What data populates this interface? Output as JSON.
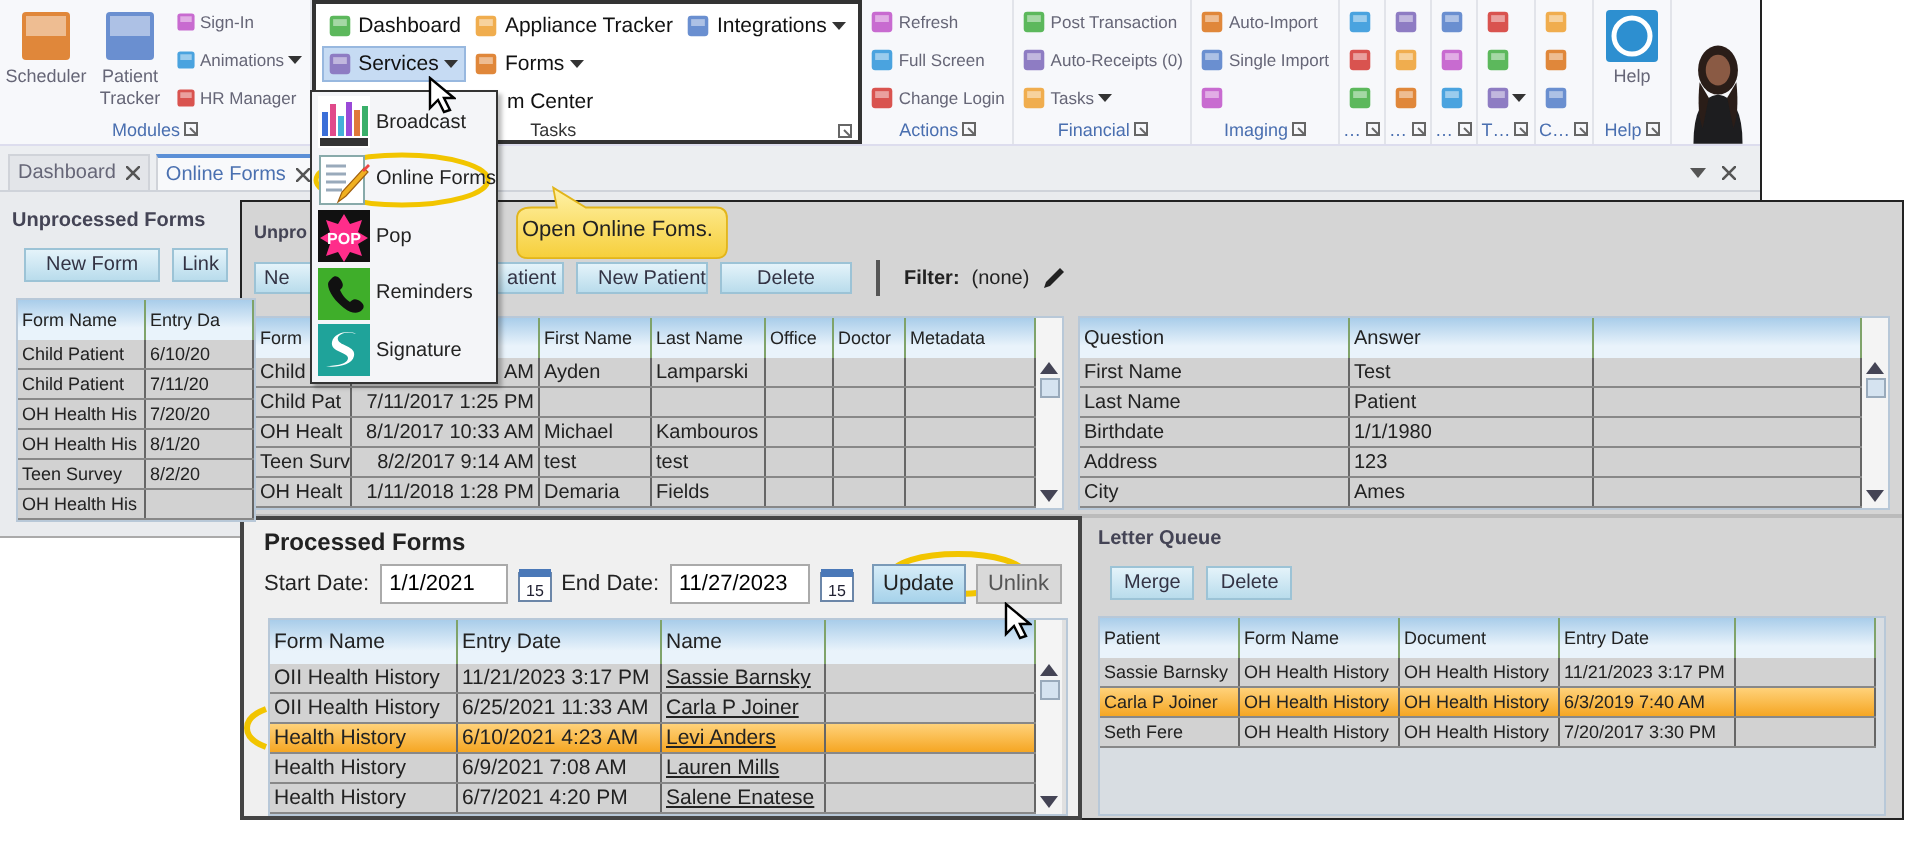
{
  "app": {
    "ribbon": {
      "groups": [
        {
          "label": "Modules",
          "columns": [
            [
              {
                "kind": "large",
                "label": "Scheduler"
              }
            ],
            [
              {
                "kind": "large",
                "label": "Patient Tracker"
              }
            ],
            [
              {
                "kind": "small",
                "label": "Sign-In"
              },
              {
                "kind": "small",
                "label": "Animations",
                "menu": true
              },
              {
                "kind": "small",
                "label": "HR Manager"
              }
            ]
          ]
        },
        {
          "kind": "focus",
          "label": "Tasks",
          "columns": [
            [
              {
                "kind": "small",
                "label": "Dashboard",
                "pressed": false
              },
              {
                "kind": "small",
                "label": "Services",
                "menu": true,
                "pressed": true
              }
            ],
            [
              {
                "kind": "small",
                "label": "Appliance Tracker",
                "pressed": false
              },
              {
                "kind": "small",
                "label": "Forms",
                "menu": true,
                "pressed": false
              },
              {
                "kind": "partial",
                "label": "m Center",
                "pressed": false
              }
            ],
            [
              {
                "kind": "small",
                "label": "Integrations",
                "menu": true,
                "pressed": false
              }
            ]
          ]
        },
        {
          "label": "Actions",
          "columns": [
            [
              {
                "kind": "small",
                "label": "Refresh"
              },
              {
                "kind": "small",
                "label": "Full Screen"
              },
              {
                "kind": "small",
                "label": "Change Login"
              }
            ]
          ]
        },
        {
          "label": "Financial",
          "columns": [
            [
              {
                "kind": "small",
                "label": "Post Transaction"
              },
              {
                "kind": "small",
                "label": "Auto-Receipts (0)"
              },
              {
                "kind": "small",
                "label": "Tasks",
                "menu": true
              }
            ]
          ]
        },
        {
          "label": "Imaging",
          "columns": [
            [
              {
                "kind": "small",
                "label": "Auto-Import"
              },
              {
                "kind": "small",
                "label": "Single Import"
              },
              {
                "kind": "icon"
              }
            ]
          ]
        },
        {
          "label": "…",
          "columns": [
            [
              {
                "kind": "icon"
              },
              {
                "kind": "icon"
              },
              {
                "kind": "icon"
              }
            ]
          ]
        },
        {
          "label": "…",
          "columns": [
            [
              {
                "kind": "icon"
              },
              {
                "kind": "icon"
              },
              {
                "kind": "icon"
              }
            ]
          ]
        },
        {
          "label": "…",
          "columns": [
            [
              {
                "kind": "icon"
              },
              {
                "kind": "icon"
              },
              {
                "kind": "icon"
              }
            ]
          ]
        },
        {
          "label": "T…",
          "columns": [
            [
              {
                "kind": "icon"
              },
              {
                "kind": "icon"
              },
              {
                "kind": "icon",
                "menu": true
              }
            ]
          ]
        },
        {
          "label": "C…",
          "columns": [
            [
              {
                "kind": "icon"
              },
              {
                "kind": "icon"
              },
              {
                "kind": "icon"
              }
            ]
          ]
        },
        {
          "label": "Help",
          "columns": [
            [
              {
                "kind": "help",
                "label": "Help"
              }
            ]
          ]
        }
      ]
    },
    "tabs": [
      {
        "label": "Dashboard",
        "selected": false
      },
      {
        "label": "Online Forms",
        "selected": true
      }
    ],
    "unprocessed": {
      "title": "Unprocessed Forms",
      "buttons": [
        "New Form",
        "Link"
      ],
      "columns": [
        "Form Name",
        "Entry Da"
      ],
      "rows": [
        [
          "Child Patient",
          "6/10/20"
        ],
        [
          "Child Patient",
          "7/11/20"
        ],
        [
          "OH Health His",
          "7/20/20"
        ],
        [
          "OH Health His",
          "8/1/20"
        ],
        [
          "Teen Survey",
          "8/2/20"
        ],
        [
          "OH Health His"
        ]
      ]
    }
  },
  "menu": {
    "items": [
      {
        "label": "Broadcast"
      },
      {
        "label": "Online Forms"
      },
      {
        "label": "Pop",
        "icon_text": "POP"
      },
      {
        "label": "Reminders"
      },
      {
        "label": "Signature"
      }
    ]
  },
  "callout": {
    "text": "Open Online Foms."
  },
  "forms_window": {
    "unprocessed": {
      "title": "Unpro",
      "buttons": [
        "Ne",
        "atient",
        "New Patient",
        "Delete"
      ],
      "filter_label": "Filter:",
      "filter_value": "(none)",
      "grid": {
        "columns": [
          "Form",
          null,
          "First Name",
          "Last Name",
          "Office",
          "Doctor",
          "Metadata"
        ],
        "rows": [
          [
            "Child",
            "AM",
            "Ayden",
            "Lamparski"
          ],
          [
            "Child Pat",
            "7/11/2017 1:25 PM"
          ],
          [
            "OH Healt",
            "8/1/2017 10:33 AM",
            "Michael",
            "Kambouros"
          ],
          [
            "Teen Surv",
            "8/2/2017 9:14 AM",
            "test",
            "test"
          ],
          [
            "OH Healt",
            "1/11/2018 1:28 PM",
            "Demaria",
            "Fields"
          ]
        ]
      },
      "details": {
        "columns": [
          "Question",
          "Answer"
        ],
        "rows": [
          [
            "First Name",
            "Test"
          ],
          [
            "Last Name",
            "Patient"
          ],
          [
            "Birthdate",
            "1/1/1980"
          ],
          [
            "Address",
            "123"
          ],
          [
            "City",
            "Ames"
          ]
        ]
      }
    },
    "processed": {
      "title": "Processed Forms",
      "start": {
        "label": "Start Date:",
        "value": "1/1/2021",
        "calendar": "15"
      },
      "end": {
        "label": "End Date:",
        "value": "11/27/2023",
        "calendar": "15"
      },
      "buttons": [
        {
          "label": "Update",
          "kind": "primary"
        },
        {
          "label": "Unlink",
          "kind": "plain"
        }
      ],
      "columns": [
        "Form Name",
        "Entry Date",
        "Name"
      ],
      "rows": [
        {
          "cells": [
            "OII Health History",
            "11/21/2023 3:17 PM",
            "Sassie Barnsky"
          ],
          "selected": false
        },
        {
          "cells": [
            "OII Health History",
            "6/25/2021 11:33 AM",
            "Carla P Joiner"
          ],
          "selected": false
        },
        {
          "cells": [
            "Health History",
            "6/10/2021 4:23 AM",
            "Levi Anders"
          ],
          "selected": true
        },
        {
          "cells": [
            "Health History",
            "6/9/2021 7:08 AM",
            "Lauren Mills"
          ],
          "selected": false
        },
        {
          "cells": [
            "Health History",
            "6/7/2021 4:20 PM",
            "Salene Enatese"
          ],
          "selected": false
        }
      ]
    },
    "letter_queue": {
      "title": "Letter Queue",
      "buttons": [
        "Merge",
        "Delete"
      ],
      "columns": [
        "Patient",
        "Form Name",
        "Document",
        "Entry Date"
      ],
      "rows": [
        {
          "cells": [
            "Sassie Barnsky",
            "OH Health History",
            "OH Health History",
            "11/21/2023 3:17 PM"
          ],
          "selected": false
        },
        {
          "cells": [
            "Carla P Joiner",
            "OH Health History",
            "OH Health History",
            "6/3/2019 7:40 AM"
          ],
          "selected": true
        },
        {
          "cells": [
            "Seth Fere",
            "OH Health History",
            "OH Health History",
            "7/20/2017 3:30 PM"
          ],
          "selected": false
        }
      ]
    }
  }
}
